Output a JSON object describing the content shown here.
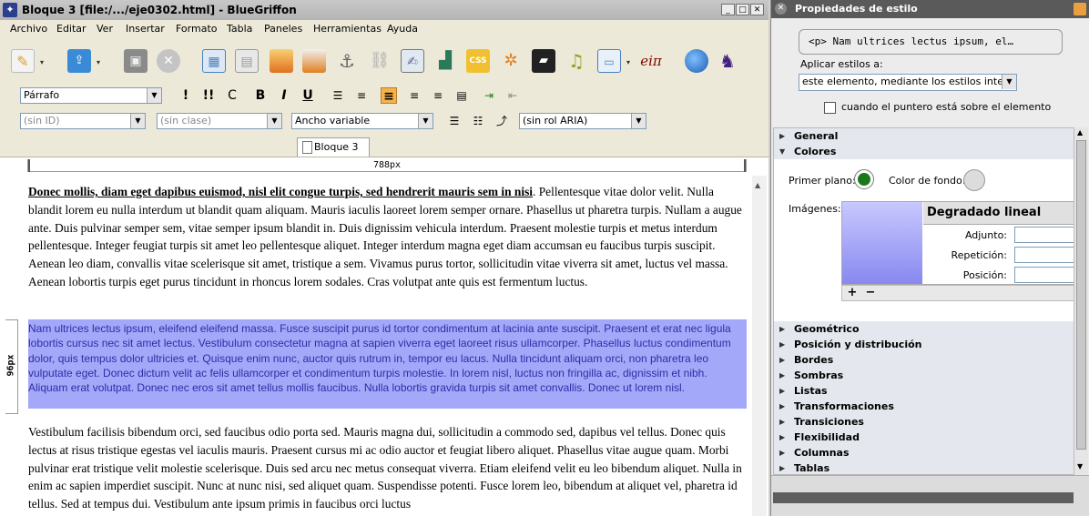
{
  "window": {
    "title": "Bloque 3 [file:/.../eje0302.html] - BlueGriffon"
  },
  "menu": [
    "Archivo",
    "Editar",
    "Ver",
    "Insertar",
    "Formato",
    "Tabla",
    "Paneles",
    "Herramientas",
    "Ayuda"
  ],
  "toolbar": {
    "icons": [
      "new-document-icon",
      "publish-icon",
      "save-icon",
      "close-document-icon",
      "table-icon",
      "grid-icon",
      "image-icon",
      "video-icon",
      "anchor-icon",
      "link-icon",
      "form-icon",
      "chart-icon",
      "css-icon",
      "script-icon",
      "media-icon",
      "audio-icon",
      "window-icon",
      "math-icon",
      "web-icon",
      "bluegriffon-logo-icon"
    ],
    "math_glyph": "eiπ"
  },
  "format": {
    "paragraph_select": "Párrafo",
    "bold": "B",
    "italic": "I",
    "underline": "U",
    "strong": "!",
    "emphasis": "!!",
    "code": "C"
  },
  "attributes": {
    "id_select": "(sin ID)",
    "class_select": "(sin clase)",
    "width_select": "Ancho variable",
    "role_select": "(sin rol ARIA)"
  },
  "tab": {
    "label": "Bloque 3"
  },
  "rulers": {
    "horizontal": "788px",
    "vertical": "96px"
  },
  "content": {
    "p1_bold": "Donec mollis, diam eget dapibus euismod, nisl elit congue turpis, sed hendrerit mauris sem in nisi",
    "p1_rest": ". Pellentesque vitae dolor velit. Nulla blandit lorem eu nulla interdum ut blandit quam aliquam. Mauris iaculis laoreet lorem semper ornare. Phasellus ut pharetra turpis. Nullam a augue ante. Duis pulvinar semper sem, vitae semper ipsum blandit in. Duis dignissim vehicula interdum. Praesent molestie turpis et metus interdum pellentesque. Integer feugiat turpis sit amet leo pellentesque aliquet. Integer interdum magna eget diam accumsan eu faucibus turpis suscipit. Aenean leo diam, convallis vitae scelerisque sit amet, tristique a sem. Vivamus purus tortor, sollicitudin vitae viverra sit amet, luctus vel massa. Aenean lobortis turpis eget purus tincidunt in rhoncus lorem sodales. Cras volutpat ante quis est fermentum luctus.",
    "p2": "Nam ultrices lectus ipsum, eleifend eleifend massa. Fusce suscipit purus id tortor condimentum at lacinia ante suscipit. Praesent et erat nec ligula lobortis cursus nec sit amet lectus. Vestibulum consectetur magna at sapien viverra eget laoreet risus ullamcorper. Phasellus luctus condimentum dolor, quis tempus dolor ultricies et. Quisque enim nunc, auctor quis rutrum in, tempor eu lacus. Nulla tincidunt aliquam orci, non pharetra leo vulputate eget. Donec dictum velit ac felis ullamcorper et condimentum turpis molestie. In lorem nisl, luctus non fringilla ac, dignissim et nibh. Aliquam erat volutpat. Donec nec eros sit amet tellus mollis faucibus. Nulla lobortis gravida turpis sit amet convallis. Donec ut lorem nisl.",
    "p3": "Vestibulum facilisis bibendum orci, sed faucibus odio porta sed. Mauris magna dui, sollicitudin a commodo sed, dapibus vel tellus. Donec quis lectus at risus tristique egestas vel iaculis mauris. Praesent cursus mi ac odio auctor et feugiat libero aliquet. Phasellus vitae augue quam. Morbi pulvinar erat tristique velit molestie scelerisque. Duis sed arcu nec metus consequat viverra. Etiam eleifend velit eu leo bibendum aliquet. Nulla in enim ac sapien imperdiet suscipit. Nunc at nunc nisi, sed aliquet quam. Suspendisse potenti. Fusce lorem leo, bibendum at aliquet vel, pharetra id tellus. Sed at tempus dui. Vestibulum ante ipsum primis in faucibus orci luctus"
  },
  "panel": {
    "title": "Propiedades de estilo",
    "selector": "<p> Nam ultrices lectus ipsum, el…",
    "apply_label": "Aplicar estilos a:",
    "apply_select": "este elemento, mediante los estilos internos",
    "hover_label": "cuando el puntero está sobre el elemento",
    "sections_top": [
      "General",
      "Colores"
    ],
    "colores": {
      "fg_label": "Primer plano:",
      "bg_label": "Color de fondo:",
      "fg_color": "#1a7a1a",
      "images_label": "Imágenes:",
      "gradient_title": "Degradado lineal",
      "fields": [
        "Adjunto:",
        "Repetición:",
        "Posición:"
      ],
      "add": "+",
      "remove": "−"
    },
    "sections_bottom": [
      "Geométrico",
      "Posición y distribución",
      "Bordes",
      "Sombras",
      "Listas",
      "Transformaciones",
      "Transiciones",
      "Flexibilidad",
      "Columnas",
      "Tablas"
    ]
  }
}
